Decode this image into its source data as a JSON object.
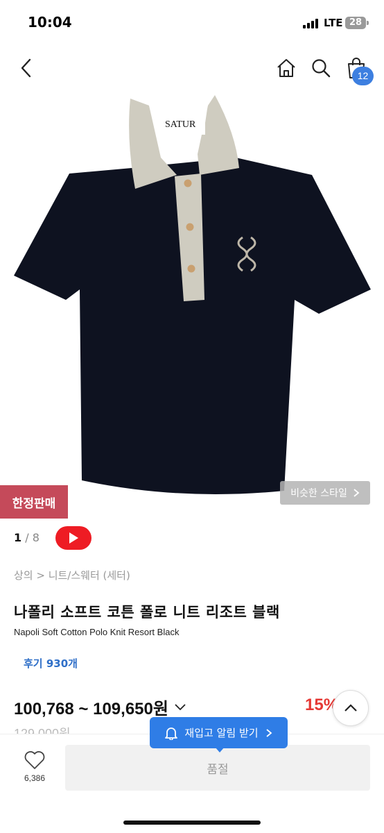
{
  "status_bar": {
    "time": "10:04",
    "network": "LTE",
    "battery": "28"
  },
  "nav": {
    "back_icon": "chevron-left-icon",
    "home_icon": "home-icon",
    "search_icon": "search-icon",
    "cart_icon": "shopping-bag-icon",
    "cart_count": "12"
  },
  "product_image": {
    "brand_label": "SATUR",
    "colors": {
      "body": "#0e1220",
      "collar": "#cfccc0"
    }
  },
  "badges": {
    "limited": "한정판매",
    "similar_style": "비슷한 스타일"
  },
  "gallery": {
    "current": "1",
    "total": "8",
    "play_icon": "play-icon"
  },
  "breadcrumb": "상의 > 니트/스웨터 (세터)",
  "product": {
    "title_ko": "나폴리 소프트 코튼 폴로 니트 리조트 블랙",
    "title_en": "Napoli Soft Cotton Polo Knit Resort Black",
    "reviews": "후기 930개",
    "price_range": "100,768 ~ 109,650원",
    "discount": "15%",
    "original_price": "129,000원"
  },
  "bottom_bar": {
    "like_count": "6,386",
    "soldout_label": "품절",
    "restock_label": "재입고 알림 받기"
  },
  "colors": {
    "accent_blue": "#2f7de6",
    "badge_red": "#c54a5a",
    "discount_red": "#e53935",
    "youtube_red": "#ee1c24"
  }
}
